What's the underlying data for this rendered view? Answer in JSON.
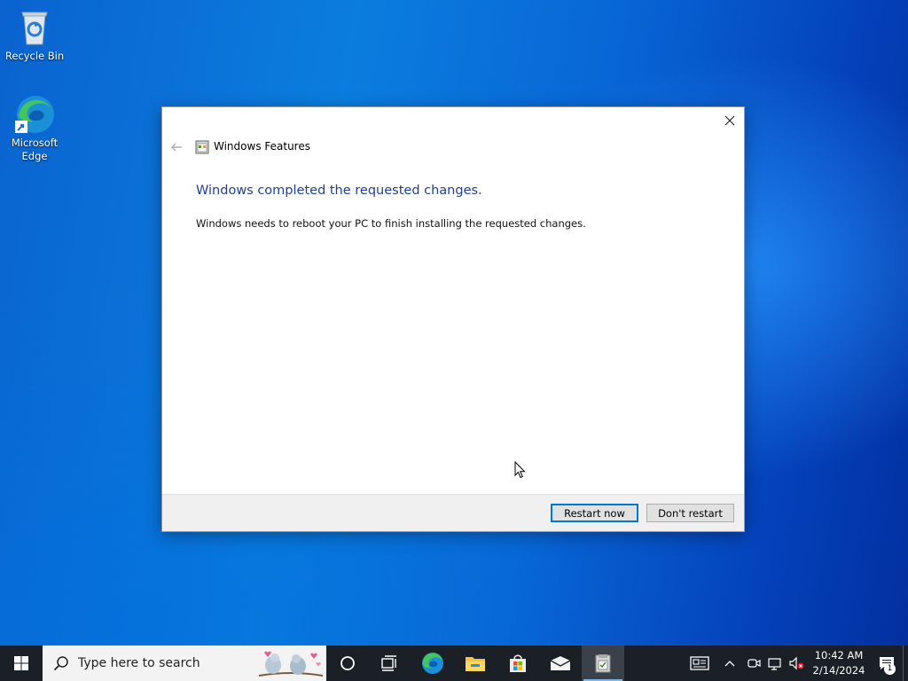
{
  "desktop": {
    "icons": [
      {
        "label": "Recycle Bin"
      },
      {
        "label": "Microsoft\nEdge"
      }
    ]
  },
  "dialog": {
    "title": "Windows Features",
    "heading": "Windows completed the requested changes.",
    "message": "Windows needs to reboot your PC to finish installing the requested changes.",
    "buttons": {
      "restart": "Restart now",
      "dont_restart": "Don't restart"
    }
  },
  "taskbar": {
    "search_placeholder": "Type here to search",
    "pinned": [
      "cortana-icon",
      "task-view-icon",
      "edge-icon",
      "file-explorer-icon",
      "store-icon",
      "mail-icon",
      "windows-features-icon"
    ],
    "clock": {
      "time": "10:42 AM",
      "date": "2/14/2024"
    },
    "notification_count": "1"
  },
  "colors": {
    "heading": "#1e3f94",
    "accent": "#0078d7",
    "taskbar": "#1b2027"
  }
}
